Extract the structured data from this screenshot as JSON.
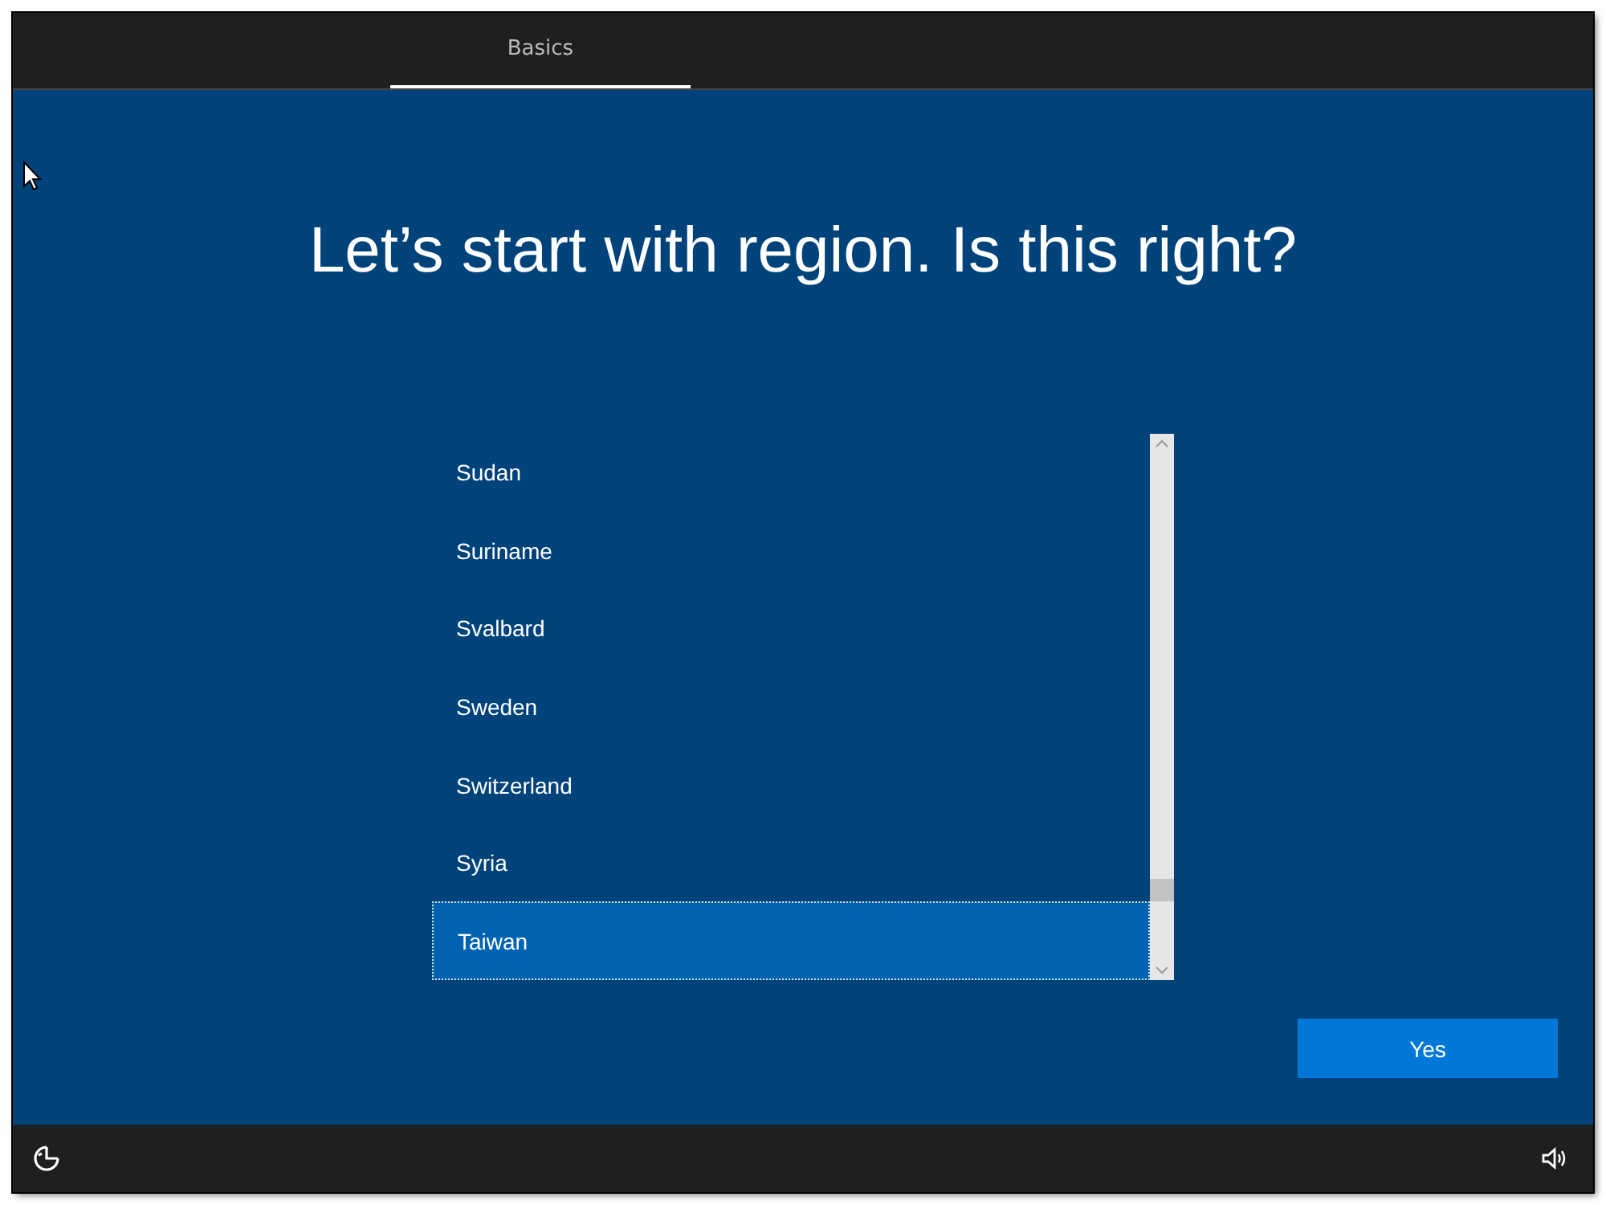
{
  "tabs": [
    {
      "label": "Basics",
      "selected": true
    }
  ],
  "title": "Let’s start with region. Is this right?",
  "regions": [
    {
      "name": "Sudan",
      "selected": false
    },
    {
      "name": "Suriname",
      "selected": false
    },
    {
      "name": "Svalbard",
      "selected": false
    },
    {
      "name": "Sweden",
      "selected": false
    },
    {
      "name": "Switzerland",
      "selected": false
    },
    {
      "name": "Syria",
      "selected": false
    },
    {
      "name": "Taiwan",
      "selected": true
    }
  ],
  "button": {
    "label": "Yes"
  }
}
